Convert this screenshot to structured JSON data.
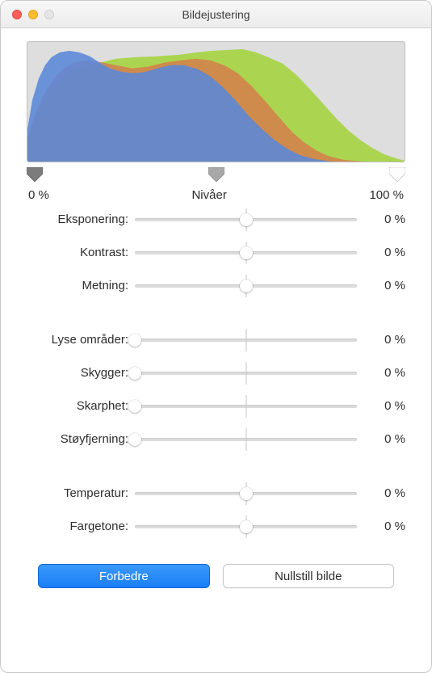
{
  "window": {
    "title": "Bildejustering"
  },
  "levels": {
    "label": "Nivåer",
    "left": "0 %",
    "right": "100 %"
  },
  "groups": [
    {
      "rows": [
        {
          "label": "Eksponering:",
          "value": "0 %",
          "thumb": 50,
          "tick": true
        },
        {
          "label": "Kontrast:",
          "value": "0 %",
          "thumb": 50,
          "tick": true
        },
        {
          "label": "Metning:",
          "value": "0 %",
          "thumb": 50,
          "tick": true
        }
      ]
    },
    {
      "rows": [
        {
          "label": "Lyse områder:",
          "value": "0 %",
          "thumb": 0,
          "tick": true
        },
        {
          "label": "Skygger:",
          "value": "0 %",
          "thumb": 0,
          "tick": true
        },
        {
          "label": "Skarphet:",
          "value": "0 %",
          "thumb": 0,
          "tick": true
        },
        {
          "label": "Støyfjerning:",
          "value": "0 %",
          "thumb": 0,
          "tick": true
        }
      ]
    },
    {
      "rows": [
        {
          "label": "Temperatur:",
          "value": "0 %",
          "thumb": 50,
          "tick": true
        },
        {
          "label": "Fargetone:",
          "value": "0 %",
          "thumb": 50,
          "tick": true
        }
      ]
    }
  ],
  "buttons": {
    "enhance": "Forbedre",
    "reset": "Nullstill bilde"
  }
}
